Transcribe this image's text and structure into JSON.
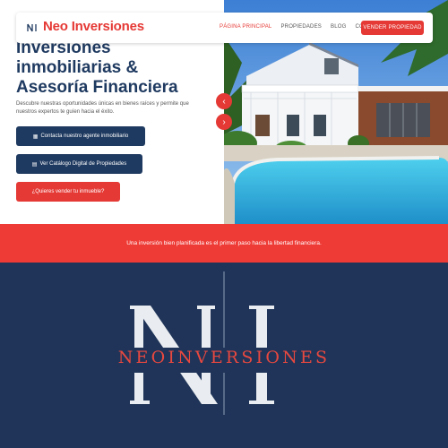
{
  "nav": {
    "brand": "Neo Inversiones",
    "links": [
      "PÁGINA PRINCIPAL",
      "PROPIEDADES",
      "BLOG",
      "CONTACTO"
    ],
    "cta": "VENDER PROPIEDAD"
  },
  "hero": {
    "headline_lines": [
      "Inversiones",
      "inmobiliarias &",
      "Asesoría Financiera"
    ],
    "subtext": "Descubre nuestras oportunidades únicas en bienes raíces y permite que nuestros expertos te guíen hacia el éxito.",
    "buttons": {
      "agent": "Contacta nuestro agente inmobiliario",
      "catalog": "Ver Catálogo Digital de Propiedades",
      "sell": "¿Quieres vender tu inmueble?"
    },
    "arrows": {
      "prev": "‹",
      "next": "›"
    }
  },
  "band": {
    "text": "Una inversión bien planificada es el primer paso hacia la libertad financiera."
  },
  "brand_panel": {
    "monogram": "NI",
    "wordmark": "NEOINVERSIONES"
  },
  "colors": {
    "navy": "#1f3a60",
    "red": "#e53935",
    "panel": "#1f3458"
  },
  "icons": {
    "agent_button": "calendar-icon",
    "catalog_button": "book-icon"
  }
}
